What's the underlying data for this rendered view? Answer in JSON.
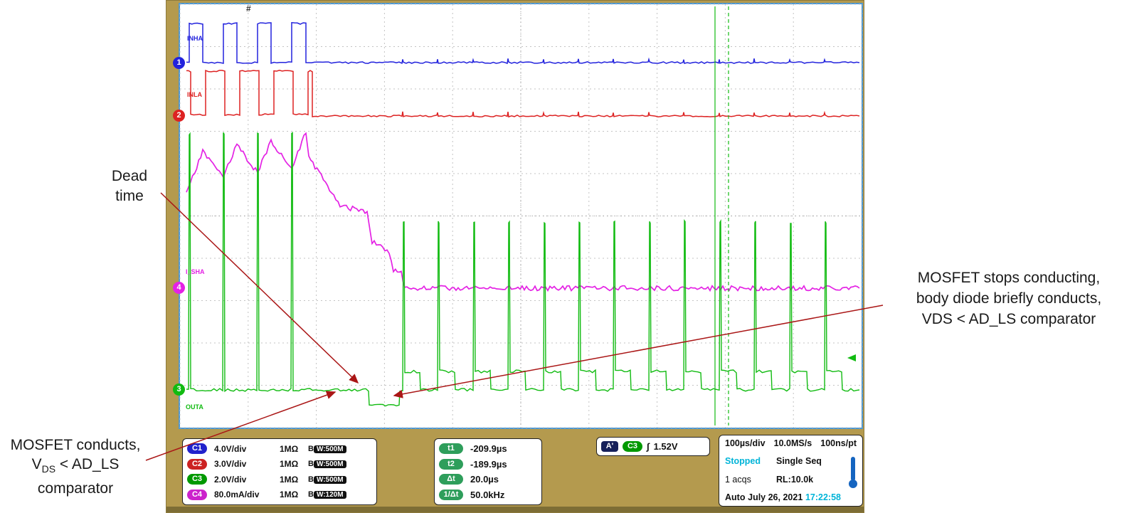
{
  "colors": {
    "ch1_blue": "#2222dd",
    "ch2_red": "#dd2222",
    "ch3_green": "#11bb11",
    "ch4_magenta": "#e422e4",
    "bezel_tan": "#b49a4e",
    "display_border_blue": "#4e97d1",
    "annotation_arrow_red": "#aa1616",
    "status_cyan": "#00b4d8",
    "grid_gray": "#c3c3c3"
  },
  "scope": {
    "trigger_position_marker": "#",
    "trace_labels": {
      "ch1": "INHA",
      "ch2": "INLA",
      "ch4": "I_SHA",
      "ch3": "OUTA"
    },
    "channel_markers": {
      "ch1": "1",
      "ch2": "2",
      "ch4": "4",
      "ch3": "3"
    },
    "readout": {
      "channels": [
        {
          "name": "C1",
          "scale": "4.0V/div",
          "impedance": "1MΩ",
          "bw_prefix": "B",
          "bw": "W:500M"
        },
        {
          "name": "C2",
          "scale": "3.0V/div",
          "impedance": "1MΩ",
          "bw_prefix": "B",
          "bw": "W:500M"
        },
        {
          "name": "C3",
          "scale": "2.0V/div",
          "impedance": "1MΩ",
          "bw_prefix": "B",
          "bw": "W:500M"
        },
        {
          "name": "C4",
          "scale": "80.0mA/div",
          "impedance": "1MΩ",
          "bw_prefix": "B",
          "bw": "W:120M"
        }
      ],
      "cursors": [
        {
          "name": "t1",
          "value": "-209.9µs"
        },
        {
          "name": "t2",
          "value": "-189.9µs"
        },
        {
          "name": "Δt",
          "value": "20.0µs"
        },
        {
          "name": "1/Δt",
          "value": "50.0kHz"
        }
      ],
      "trigger": {
        "badge": "A'",
        "source": "C3",
        "edge_symbol": "∫",
        "level": "1.52V"
      },
      "timebase": {
        "scale": "100µs/div",
        "sample_rate": "10.0MS/s",
        "resolution": "100ns/pt"
      },
      "acquisition": {
        "status": "Stopped",
        "mode": "Single Seq",
        "count": "1 acqs",
        "record_length": "RL:10.0k",
        "trigger_mode": "Auto",
        "date": "July 26, 2021",
        "time": "17:22:58"
      }
    }
  },
  "annotations": {
    "dead_time_line1": "Dead",
    "dead_time_line2": "time",
    "right_line1": "MOSFET stops conducting,",
    "right_line2": "body diode briefly conducts,",
    "right_line3": "VDS < AD_LS comparator",
    "bottom_left_line1": "MOSFET conducts,",
    "bottom_left_v": "V",
    "bottom_left_sub": "DS",
    "bottom_left_rest": " < AD_LS",
    "bottom_left_line3": "comparator"
  }
}
